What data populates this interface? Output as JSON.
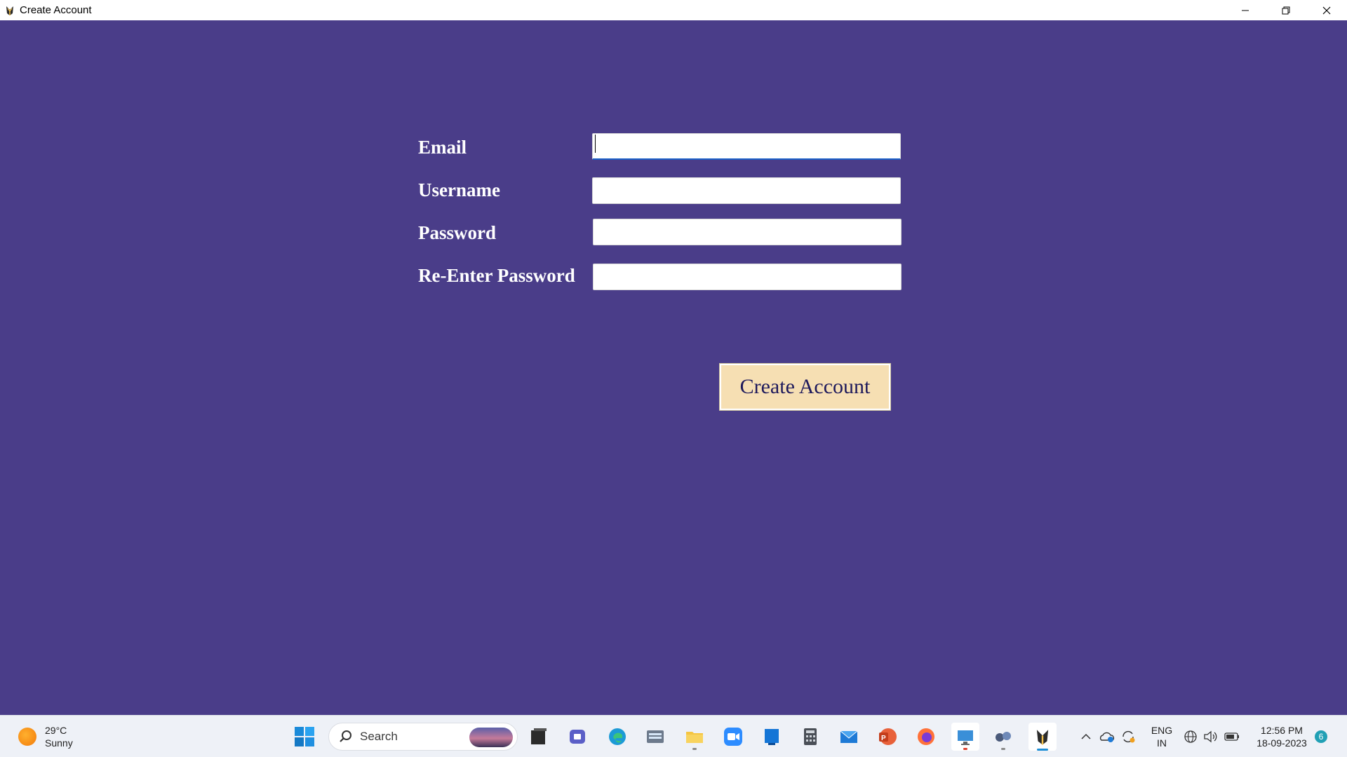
{
  "window": {
    "title": "Create Account",
    "app_icon": "tkinter-feather-icon",
    "controls": [
      "minimize-icon",
      "restore-icon",
      "close-icon"
    ]
  },
  "form": {
    "email_label": "Email",
    "username_label": "Username",
    "password_label": "Password",
    "reenter_password_label": "Re-Enter Password",
    "email_value": "",
    "username_value": "",
    "password_value": "",
    "reenter_password_value": "",
    "create_button": "Create Account"
  },
  "colors": {
    "background": "#4a3d89",
    "button_bg": "#f6dfb3",
    "button_text": "#1e1a5c",
    "label_text": "#ffffff"
  },
  "taskbar": {
    "weather": {
      "temp": "29°C",
      "condition": "Sunny",
      "icon": "sun-icon"
    },
    "search_placeholder": "Search",
    "apps": [
      "windows-start-icon",
      "file-explorer-icon",
      "teams-icon",
      "edge-icon",
      "keyboard-app-icon",
      "folder-icon",
      "zoom-icon",
      "store-icon",
      "calculator-icon",
      "mail-icon",
      "powerpoint-icon",
      "firefox-icon",
      "remote-desktop-icon",
      "app-icon",
      "tkinter-app-icon"
    ],
    "tray": {
      "lang_top": "ENG",
      "lang_bottom": "IN",
      "time": "12:56 PM",
      "date": "18-09-2023",
      "notification_count": "6"
    }
  }
}
